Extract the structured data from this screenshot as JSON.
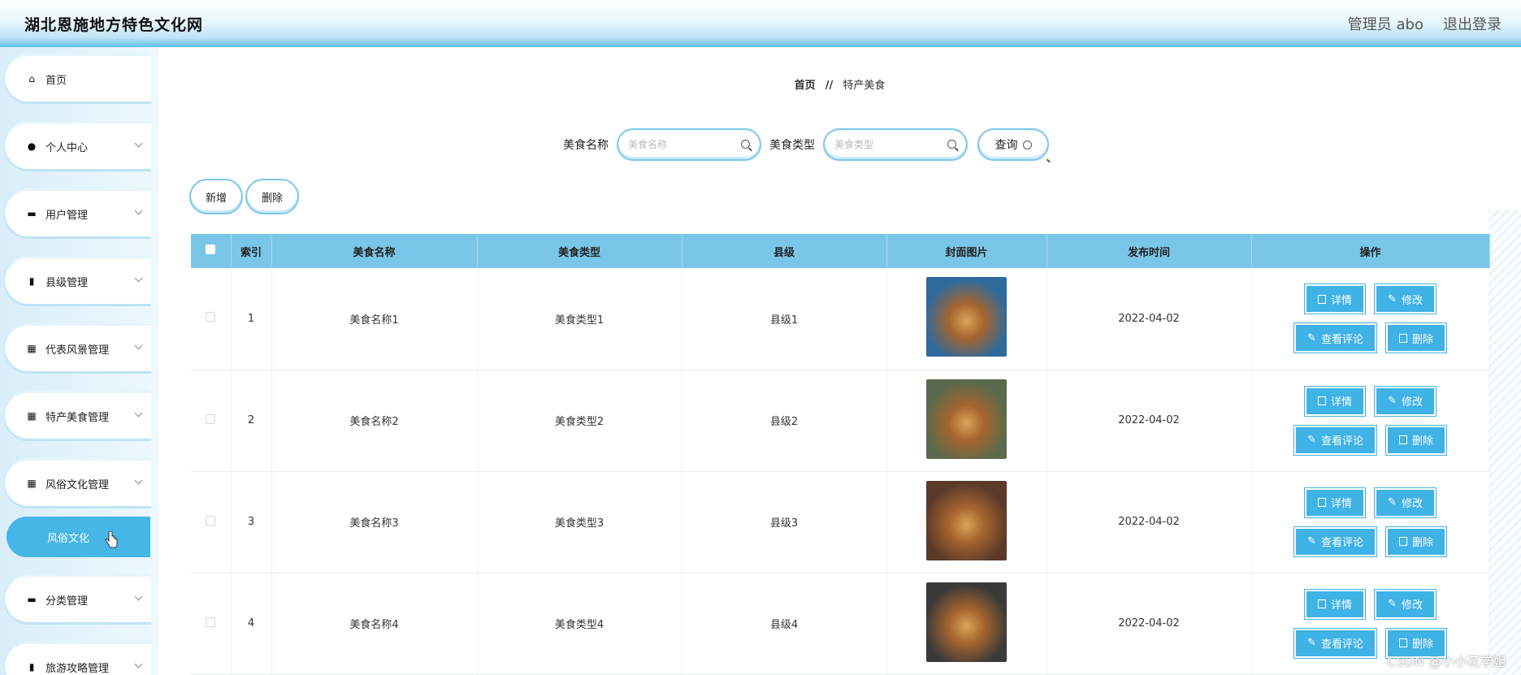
{
  "header": {
    "title": "湖北恩施地方特色文化网",
    "user": "管理员 abo",
    "logout": "退出登录"
  },
  "sidebar": {
    "items": [
      {
        "label": "首页",
        "icon": "home-icon",
        "glyph": "⌂"
      },
      {
        "label": "个人中心",
        "icon": "user-icon",
        "glyph": "●"
      },
      {
        "label": "用户管理",
        "icon": "briefcase-icon",
        "glyph": "▬"
      },
      {
        "label": "县级管理",
        "icon": "clipboard-icon",
        "glyph": "▮"
      },
      {
        "label": "代表风景管理",
        "icon": "grid-icon",
        "glyph": "▦"
      },
      {
        "label": "特产美食管理",
        "icon": "apps-icon",
        "glyph": "▦"
      },
      {
        "label": "风俗文化管理",
        "icon": "grid-icon",
        "glyph": "▦"
      }
    ],
    "active_sub": "风俗文化",
    "items_after": [
      {
        "label": "分类管理",
        "icon": "monitor-icon",
        "glyph": "▬"
      },
      {
        "label": "旅游攻略管理",
        "icon": "bag-icon",
        "glyph": "▮"
      }
    ]
  },
  "breadcrumb": {
    "home": "首页",
    "sep": "//",
    "current": "特产美食"
  },
  "search": {
    "name_label": "美食名称",
    "name_placeholder": "美食名称",
    "type_label": "美食类型",
    "type_placeholder": "美食类型",
    "query_label": "查询"
  },
  "actions": {
    "add": "新增",
    "delete": "删除"
  },
  "table": {
    "headers": [
      "索引",
      "美食名称",
      "美食类型",
      "县级",
      "封面图片",
      "发布时间",
      "操作"
    ],
    "rows": [
      {
        "index": "1",
        "name": "美食名称1",
        "type": "美食类型1",
        "county": "县级1",
        "date": "2022-04-02",
        "image_color": "#2f6a9c"
      },
      {
        "index": "2",
        "name": "美食名称2",
        "type": "美食类型2",
        "county": "县级2",
        "date": "2022-04-02",
        "image_color": "#5a6a4c"
      },
      {
        "index": "3",
        "name": "美食名称3",
        "type": "美食类型3",
        "county": "县级3",
        "date": "2022-04-02",
        "image_color": "#5b3a2a"
      },
      {
        "index": "4",
        "name": "美食名称4",
        "type": "美食类型4",
        "county": "县级4",
        "date": "2022-04-02",
        "image_color": "#3a3a38"
      }
    ],
    "ops": {
      "detail": "详情",
      "edit": "修改",
      "comments": "查看评论",
      "delete": "删除"
    }
  },
  "watermark": "CSDN @小小花学姐"
}
